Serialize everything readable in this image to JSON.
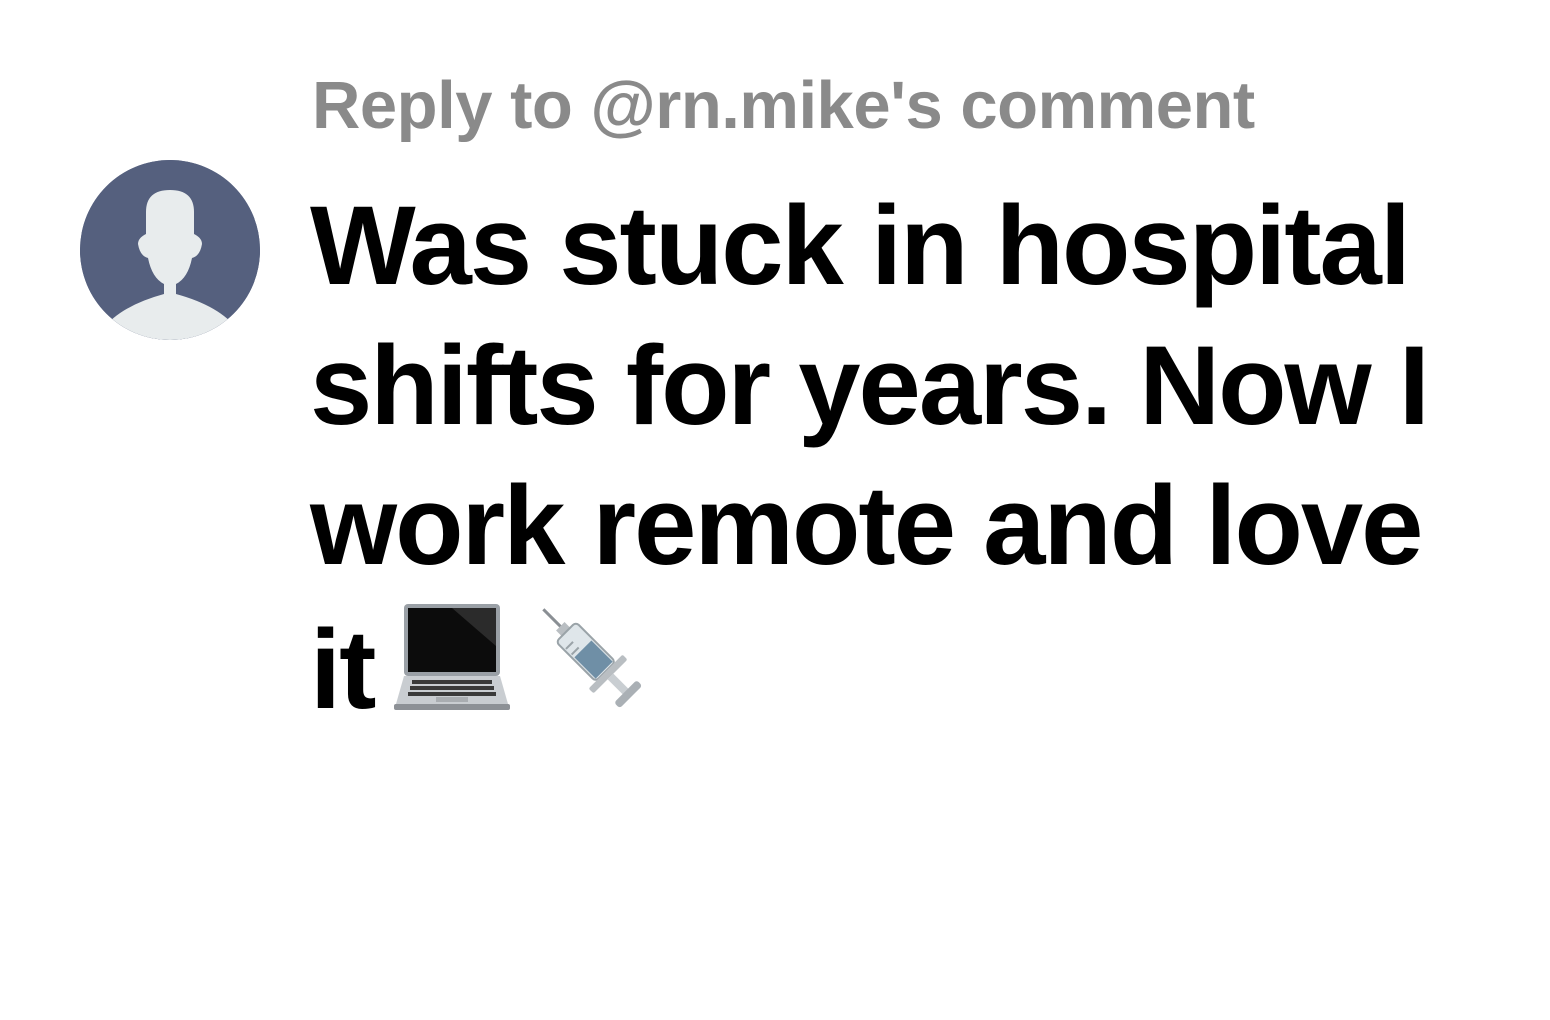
{
  "reply": {
    "header": "Reply to @rn.mike's comment",
    "body_text": "Was stuck in hospital shifts for years. Now I work remote and love it",
    "emojis": [
      "laptop-icon",
      "syringe-icon"
    ]
  },
  "colors": {
    "header_text": "#8a8a8a",
    "body_text": "#000000",
    "avatar_bg": "#55607e",
    "avatar_figure": "#e8eced",
    "background": "#ffffff"
  }
}
